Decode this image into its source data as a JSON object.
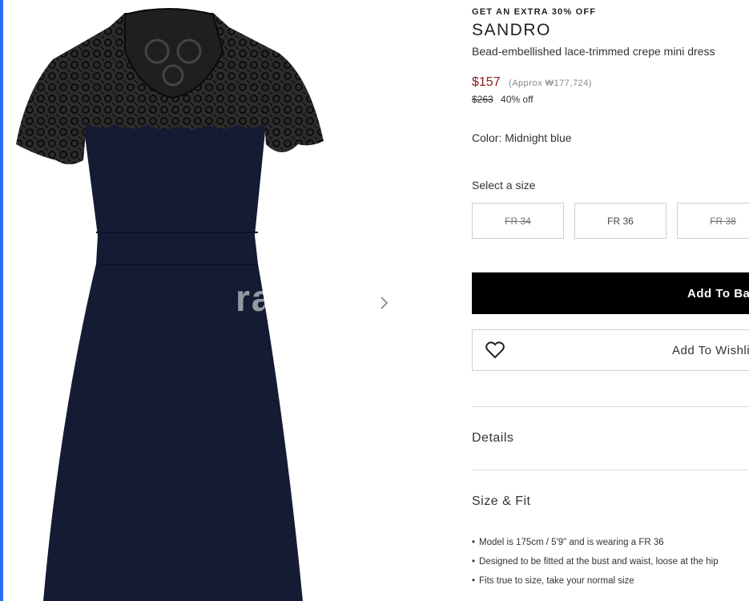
{
  "product": {
    "promo": "GET AN EXTRA 30% OFF",
    "brand": "SANDRO",
    "name": "Bead-embellished lace-trimmed crepe mini dress",
    "sale_price": "$157",
    "approx_price": "(Approx ₩177,724)",
    "original_price": "$263",
    "discount": "40% off",
    "color_label": "Color:",
    "color_value": "Midnight blue"
  },
  "sizes": {
    "title": "Select a size",
    "options": [
      {
        "label": "FR 34",
        "available": false
      },
      {
        "label": "FR 36",
        "available": true
      },
      {
        "label": "FR 38",
        "available": false
      }
    ]
  },
  "actions": {
    "add_to_bag": "Add To Bag",
    "add_to_wishlist": "Add To Wishlist"
  },
  "accordion": {
    "details": "Details",
    "size_fit": "Size & Fit"
  },
  "size_fit_notes": [
    "Model is 175cm / 5'9\" and is wearing a FR 36",
    "Designed to be fitted at the bust and waist, loose at the hip",
    "Fits true to size, take your normal size"
  ],
  "gallery": {
    "watermark": "ra",
    "next_icon": "chevron-right-icon"
  },
  "colors": {
    "accent_border": "#2a6df4",
    "sale_red": "#8b1a1a",
    "dress_navy": "#141b33",
    "lace_black": "#1a1a1a"
  }
}
